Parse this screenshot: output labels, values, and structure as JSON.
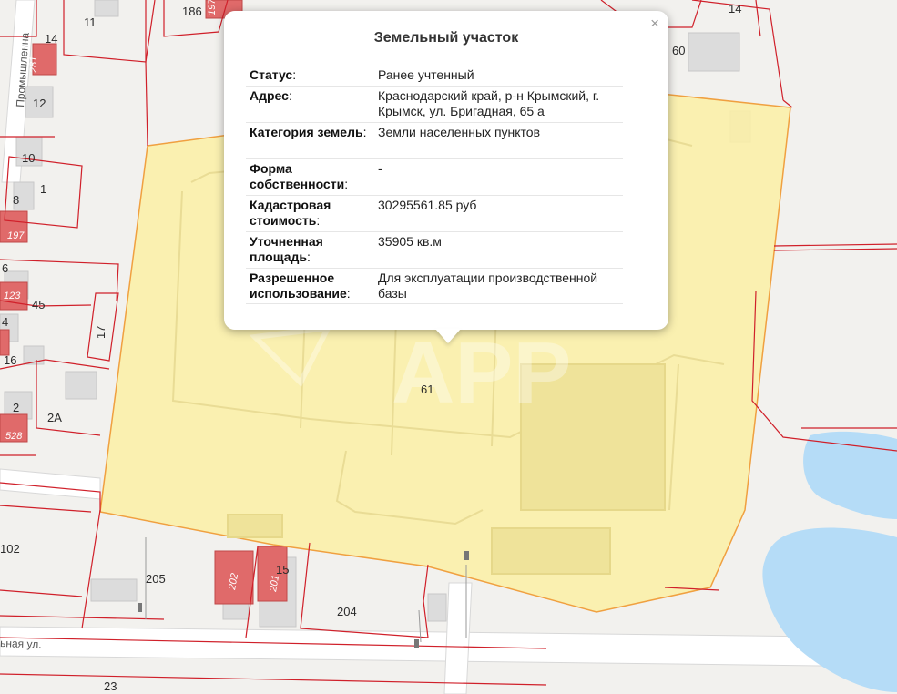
{
  "popup": {
    "title": "Земельный участок",
    "close_symbol": "×",
    "rows": [
      {
        "key": "Статус",
        "value": "Ранее учтенный"
      },
      {
        "key": "Адрес",
        "value": "Краснодарский край, р-н Крымский, г. Крымск, ул. Бригадная, 65 а"
      },
      {
        "key": "Категория земель",
        "value": "Земли населенных пунктов"
      },
      {
        "key": "Форма собственности",
        "value": "-"
      },
      {
        "key": "Кадастровая стоимость",
        "value": "30295561.85 руб"
      },
      {
        "key": "Уточненная площадь",
        "value": "35905 кв.м"
      },
      {
        "key": "Разрешенное использование",
        "value": "Для эксплуатации производственной базы"
      }
    ],
    "scrollbar_position": 0.1
  },
  "map": {
    "watermark": "APP",
    "street_labels": [
      "Промышленна",
      "ьная ул."
    ],
    "parcel_labels": [
      "186",
      "197",
      "14",
      "11",
      "60",
      "14",
      "281",
      "12",
      "10",
      "1",
      "8",
      "197",
      "6",
      "123",
      "45",
      "4",
      "17",
      "16",
      "2",
      "2А",
      "528",
      "61",
      "102",
      "205",
      "202",
      "201",
      "15",
      "204",
      "23"
    ],
    "colors": {
      "background": "#f2f1ee",
      "selected_parcel_fill": "#fbf0a4",
      "selected_parcel_stroke": "#f0a040",
      "boundary": "#d0202a",
      "building": "#dcdcdc",
      "red_building": "#e06a6a",
      "water": "#b5dcf7",
      "road": "#ffffff"
    }
  }
}
